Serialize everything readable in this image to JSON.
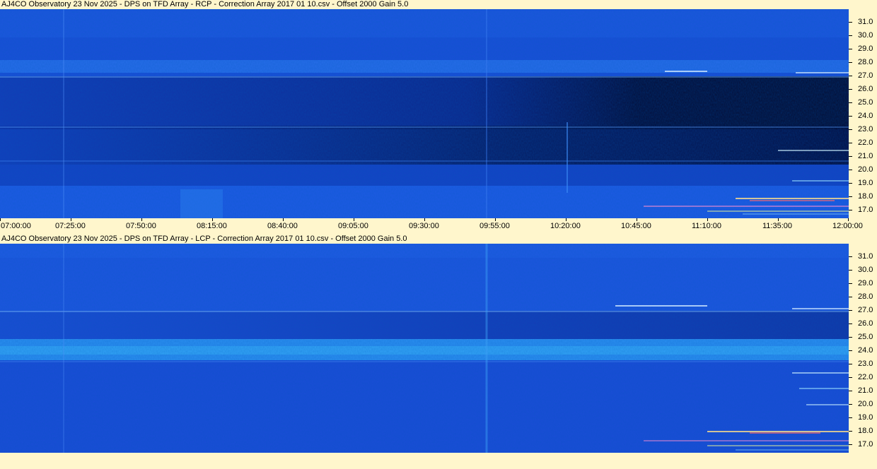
{
  "panels": [
    {
      "id": "rcp",
      "title": "AJ4CO Observatory 23 Nov 2025  -  DPS on TFD Array  -  RCP  -  Correction Array 2017 01 10.csv  -  Offset 2000  Gain 5.0",
      "y_labels": [
        "31.0",
        "30.0",
        "29.0",
        "28.0",
        "27.0",
        "26.0",
        "25.0",
        "24.0",
        "23.0",
        "22.0",
        "21.0",
        "20.0",
        "19.0",
        "18.0",
        "17.0"
      ]
    },
    {
      "id": "lcp",
      "title": "AJ4CO Observatory 23 Nov 2025  -  DPS on TFD Array  -  LCP  -  Correction Array 2017 01 10.csv  -  Offset 2000  Gain 5.0",
      "y_labels": [
        "31.0",
        "30.0",
        "29.0",
        "28.0",
        "27.0",
        "26.0",
        "25.0",
        "24.0",
        "23.0",
        "22.0",
        "21.0",
        "20.0",
        "19.0",
        "18.0",
        "17.0"
      ]
    }
  ],
  "time_axis": {
    "labels": [
      "07:00:00",
      "07:25:00",
      "07:50:00",
      "08:15:00",
      "08:40:00",
      "09:05:00",
      "09:30:00",
      "09:55:00",
      "10:20:00",
      "10:45:00",
      "11:10:00",
      "11:35:00",
      "12:00:00"
    ]
  },
  "colors": {
    "background": "#fff6cc",
    "spectrogram_base": "#1a4fd8",
    "spectrogram_bright": "#2a9cf0",
    "spectrogram_dark": "#020a30"
  }
}
